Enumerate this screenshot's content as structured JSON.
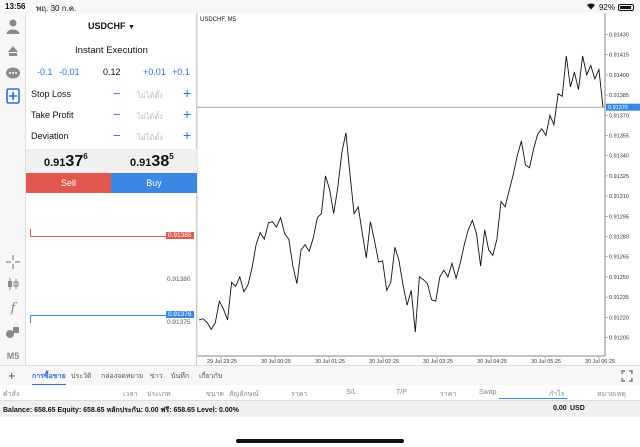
{
  "status": {
    "time": "13:56",
    "date": "พฤ. 30 ก.ค.",
    "battery": "92%",
    "battery_level": 0.92
  },
  "order": {
    "symbol": "USDCHF",
    "execution": "Instant Execution",
    "steps": [
      "-0.1",
      "-0.01",
      "0.12",
      "+0.01",
      "+0.1"
    ],
    "fields": [
      {
        "label": "Stop Loss",
        "placeholder": "ไม่ได้ตั้ง"
      },
      {
        "label": "Take Profit",
        "placeholder": "ไม่ได้ตั้ง"
      },
      {
        "label": "Deviation",
        "placeholder": "ไม่ได้ตั้ง"
      }
    ],
    "sell_price": {
      "main": "0.91",
      "big": "37",
      "sup": "6"
    },
    "buy_price": {
      "main": "0.91",
      "big": "38",
      "sup": "5"
    },
    "sell_label": "Sell",
    "buy_label": "Buy",
    "ladder": {
      "ask_label": "0.91385",
      "mid_label": "0.91380",
      "bid_label": "0.91376",
      "low_label": "0.91375"
    }
  },
  "chart_data": {
    "type": "line",
    "title": "USDCHF, M5",
    "current_price_label": "0.91376",
    "y_ticks": [
      "0.91430",
      "0.91415",
      "0.91400",
      "0.91385",
      "0.91370",
      "0.91355",
      "0.91340",
      "0.91325",
      "0.91310",
      "0.91295",
      "0.91280",
      "0.91265",
      "0.91250",
      "0.91235",
      "0.91220",
      "0.91205"
    ],
    "x_ticks": [
      "29 Jul 23:25",
      "30 Jul 00:25",
      "30 Jul 01:25",
      "30 Jul 02:25",
      "30 Jul 03:25",
      "30 Jul 04:25",
      "30 Jul 05:25",
      "30 Jul 06:25"
    ],
    "ylim": [
      0.91195,
      0.9144
    ],
    "values": [
      0.91218,
      0.91219,
      0.91216,
      0.91211,
      0.91216,
      0.91232,
      0.91226,
      0.91218,
      0.91246,
      0.91243,
      0.9125,
      0.91239,
      0.91244,
      0.91257,
      0.91274,
      0.91283,
      0.91278,
      0.9129,
      0.91291,
      0.91287,
      0.91294,
      0.91282,
      0.91278,
      0.91258,
      0.91245,
      0.9127,
      0.91274,
      0.91269,
      0.91279,
      0.91294,
      0.91297,
      0.91325,
      0.91315,
      0.91297,
      0.91316,
      0.91342,
      0.91357,
      0.91326,
      0.91297,
      0.91302,
      0.91283,
      0.91264,
      0.91291,
      0.91277,
      0.91261,
      0.91262,
      0.9124,
      0.91246,
      0.91272,
      0.91262,
      0.91244,
      0.91229,
      0.9124,
      0.91209,
      0.9125,
      0.91248,
      0.91245,
      0.91233,
      0.91232,
      0.9125,
      0.91255,
      0.9125,
      0.9126,
      0.91249,
      0.9126,
      0.91274,
      0.91285,
      0.91292,
      0.91282,
      0.91258,
      0.91285,
      0.9127,
      0.91266,
      0.91278,
      0.91306,
      0.91302,
      0.91314,
      0.91326,
      0.9134,
      0.91351,
      0.91333,
      0.91331,
      0.91345,
      0.91356,
      0.9136,
      0.91355,
      0.9137,
      0.91363,
      0.91386,
      0.91384,
      0.91414,
      0.91391,
      0.91402,
      0.91389,
      0.91414,
      0.914,
      0.91407,
      0.91397,
      0.91404,
      0.91376
    ]
  },
  "tabs": [
    "การซื้อขาย",
    "ประวัติ",
    "กล่องจดหมาย",
    "ข่าว",
    "บันทึก",
    "เกี่ยวกับ"
  ],
  "columns": [
    "คำสั่ง",
    "เวลา",
    "ประเภท",
    "ขนาด",
    "สัญลักษณ์",
    "ราคา",
    "S/L",
    "T/P",
    "ราคา",
    "Swap",
    "กำไร",
    "หมายเหตุ"
  ],
  "balance": {
    "text": "Balance: 658.65 Equity: 658.65 หลักประกัน: 0.00 ฟรี: 658.65 Level: 0.00%",
    "profit": "0.00",
    "currency": "USD"
  },
  "colors": {
    "sell": "#e1594e",
    "buy": "#3b87e4",
    "accent": "#2f6fd6",
    "price_tag": "#3b87e4"
  },
  "icons": [
    "user-icon",
    "trade-arrows-icon",
    "chat-icon",
    "new-order-icon",
    "crosshair-icon",
    "candles-icon",
    "function-icon",
    "objects-icon",
    "timeframe-icon",
    "add-icon",
    "fullscreen-icon",
    "wifi-icon",
    "battery-icon"
  ]
}
